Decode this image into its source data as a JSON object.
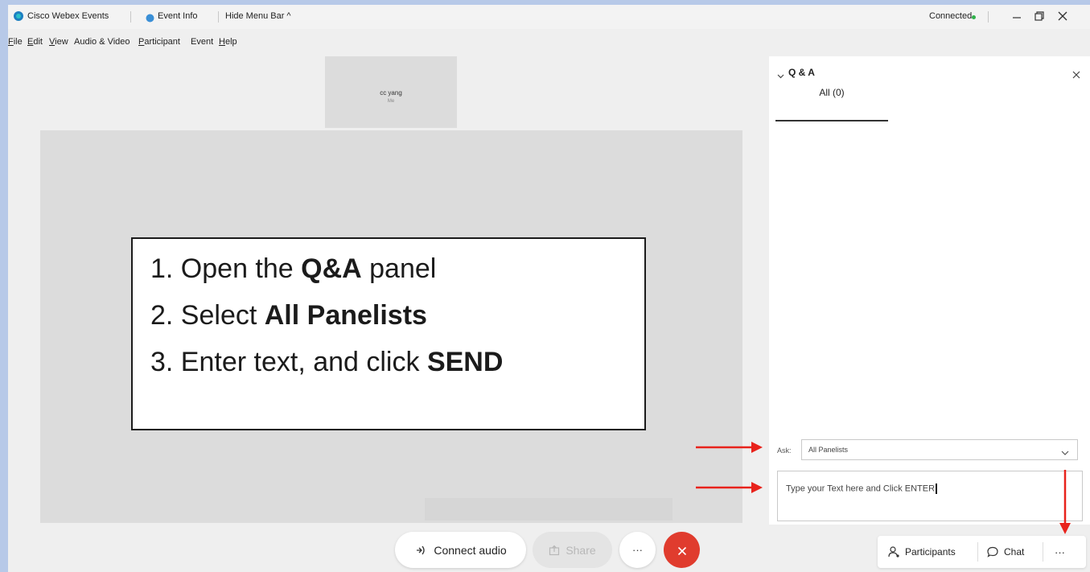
{
  "titlebar": {
    "app_title": "Cisco Webex Events",
    "event_info": "Event Info",
    "hide_menu": "Hide Menu Bar ^",
    "status": "Connected",
    "status_color": "#2fb24a"
  },
  "menu": {
    "file": {
      "key": "F",
      "rest": "ile"
    },
    "edit": {
      "key": "E",
      "rest": "dit"
    },
    "view": {
      "key": "V",
      "rest": "iew"
    },
    "audio": "Audio & Video",
    "participant": {
      "key": "P",
      "rest": "articipant"
    },
    "event": "Event",
    "help": {
      "key": "H",
      "rest": "elp"
    }
  },
  "self_tile": {
    "name": "cc yang",
    "sub": "Me"
  },
  "instructions": {
    "line1_pre": "1. Open the ",
    "line1_bold": "Q&A",
    "line1_post": " panel",
    "line2_pre": "2. Select ",
    "line2_bold": "All Panelists",
    "line3_pre": "3. Enter text, and click ",
    "line3_bold": "SEND"
  },
  "controls": {
    "connect_audio": "Connect audio",
    "share": "Share",
    "more": "···",
    "end_color": "#e03c2e"
  },
  "qa_panel": {
    "title": "Q & A",
    "tab_all": "All (0)",
    "ask_label": "Ask:",
    "ask_value": "All Panelists",
    "input_text": "Type your Text here and Click ENTER"
  },
  "bottom_bar": {
    "participants": "Participants",
    "chat": "Chat",
    "more": "···"
  },
  "annotation_color": "#e8231c"
}
